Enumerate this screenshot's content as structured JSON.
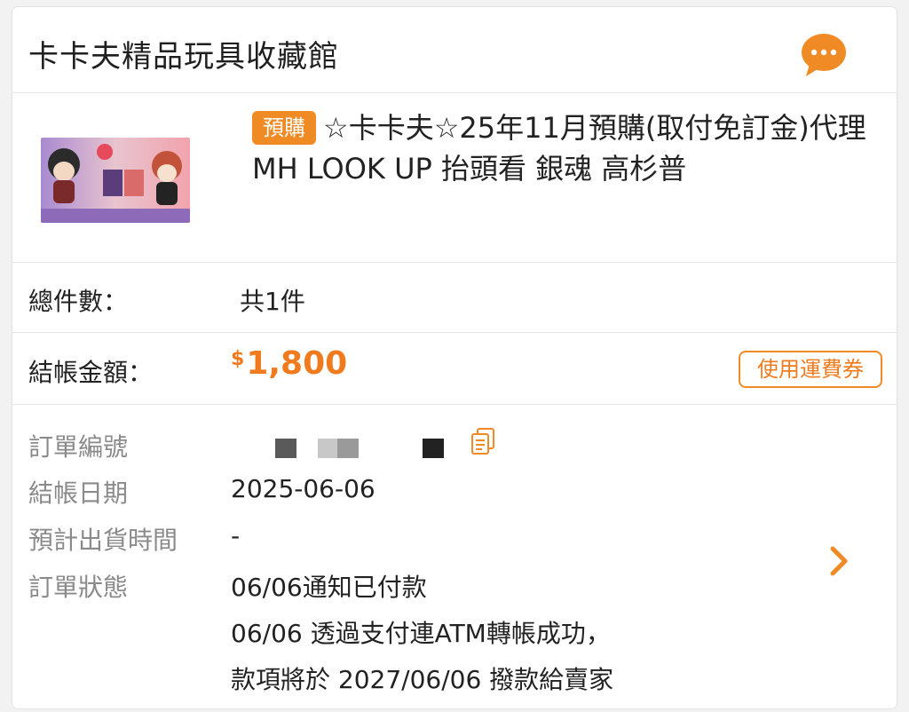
{
  "shop": {
    "name": "卡卡夫精品玩具收藏館",
    "chat_icon": "chat-bubble-icon"
  },
  "product": {
    "badge": "預購",
    "title": "☆卡卡夫☆25年11月預購(取付免訂金)代理 MH LOOK UP 抬頭看 銀魂 高杉普"
  },
  "summary": {
    "count_label": "總件數：",
    "count_value": "共1件",
    "total_label": "結帳金額：",
    "currency": "$",
    "amount": "1,800",
    "coupon_button": "使用運費券"
  },
  "details": {
    "order_no_label": "訂單編號",
    "date_label": "結帳日期",
    "date_value": "2025-06-06",
    "ship_label": "預計出貨時間",
    "ship_value": "-",
    "status_label": "訂單狀態",
    "status_lines": [
      "06/06通知已付款",
      "06/06 透過支付連ATM轉帳成功，",
      "款項將於 2027/06/06 撥款給賣家"
    ]
  },
  "colors": {
    "accent": "#f07b1f",
    "badge": "#f08a24"
  }
}
